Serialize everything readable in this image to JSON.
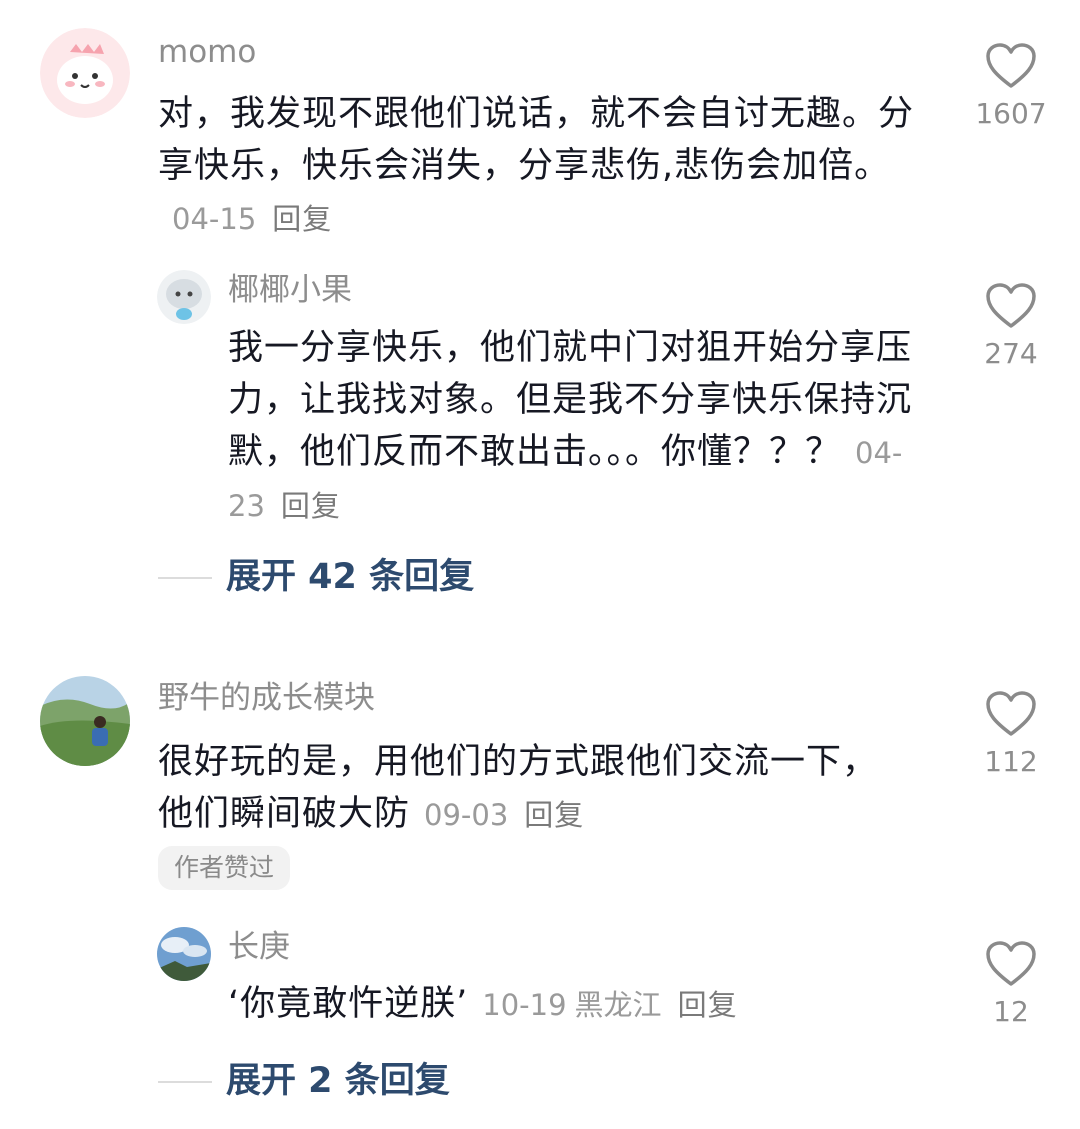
{
  "comments": [
    {
      "username": "momo",
      "text": "对，我发现不跟他们说话，就不会自讨无趣。分享快乐，快乐会消失，分享悲伤,悲伤会加倍。",
      "date": "04-15",
      "reply_label": "回复",
      "likes": "1607",
      "avatar_icon": "pink-monster-avatar",
      "replies": [
        {
          "username": "椰椰小果",
          "text": "我一分享快乐，他们就中门对狙开始分享压力，让我找对象。但是我不分享快乐保持沉默，他们反而不敢出击。。。你懂？？？",
          "date": "04-23",
          "reply_label": "回复",
          "likes": "274",
          "avatar_icon": "cartoon-avatar"
        }
      ],
      "expand_label": "展开 42 条回复"
    },
    {
      "username": "野牛的成长模块",
      "text": "很好玩的是，用他们的方式跟他们交流一下，他们瞬间破大防",
      "date": "09-03",
      "reply_label": "回复",
      "likes": "112",
      "badge": "作者赞过",
      "avatar_icon": "landscape-avatar",
      "replies": [
        {
          "username": "长庚",
          "text": "‘你竟敢忤逆朕’",
          "date": "10-19",
          "location": "黑龙江",
          "reply_label": "回复",
          "likes": "12",
          "avatar_icon": "sky-avatar"
        }
      ],
      "expand_label": "展开 2 条回复"
    }
  ],
  "colors": {
    "text": "#161823",
    "muted": "#8d8d8d",
    "expand_link": "#2d4a6e"
  },
  "icons": {
    "like": "heart-outline-icon"
  }
}
